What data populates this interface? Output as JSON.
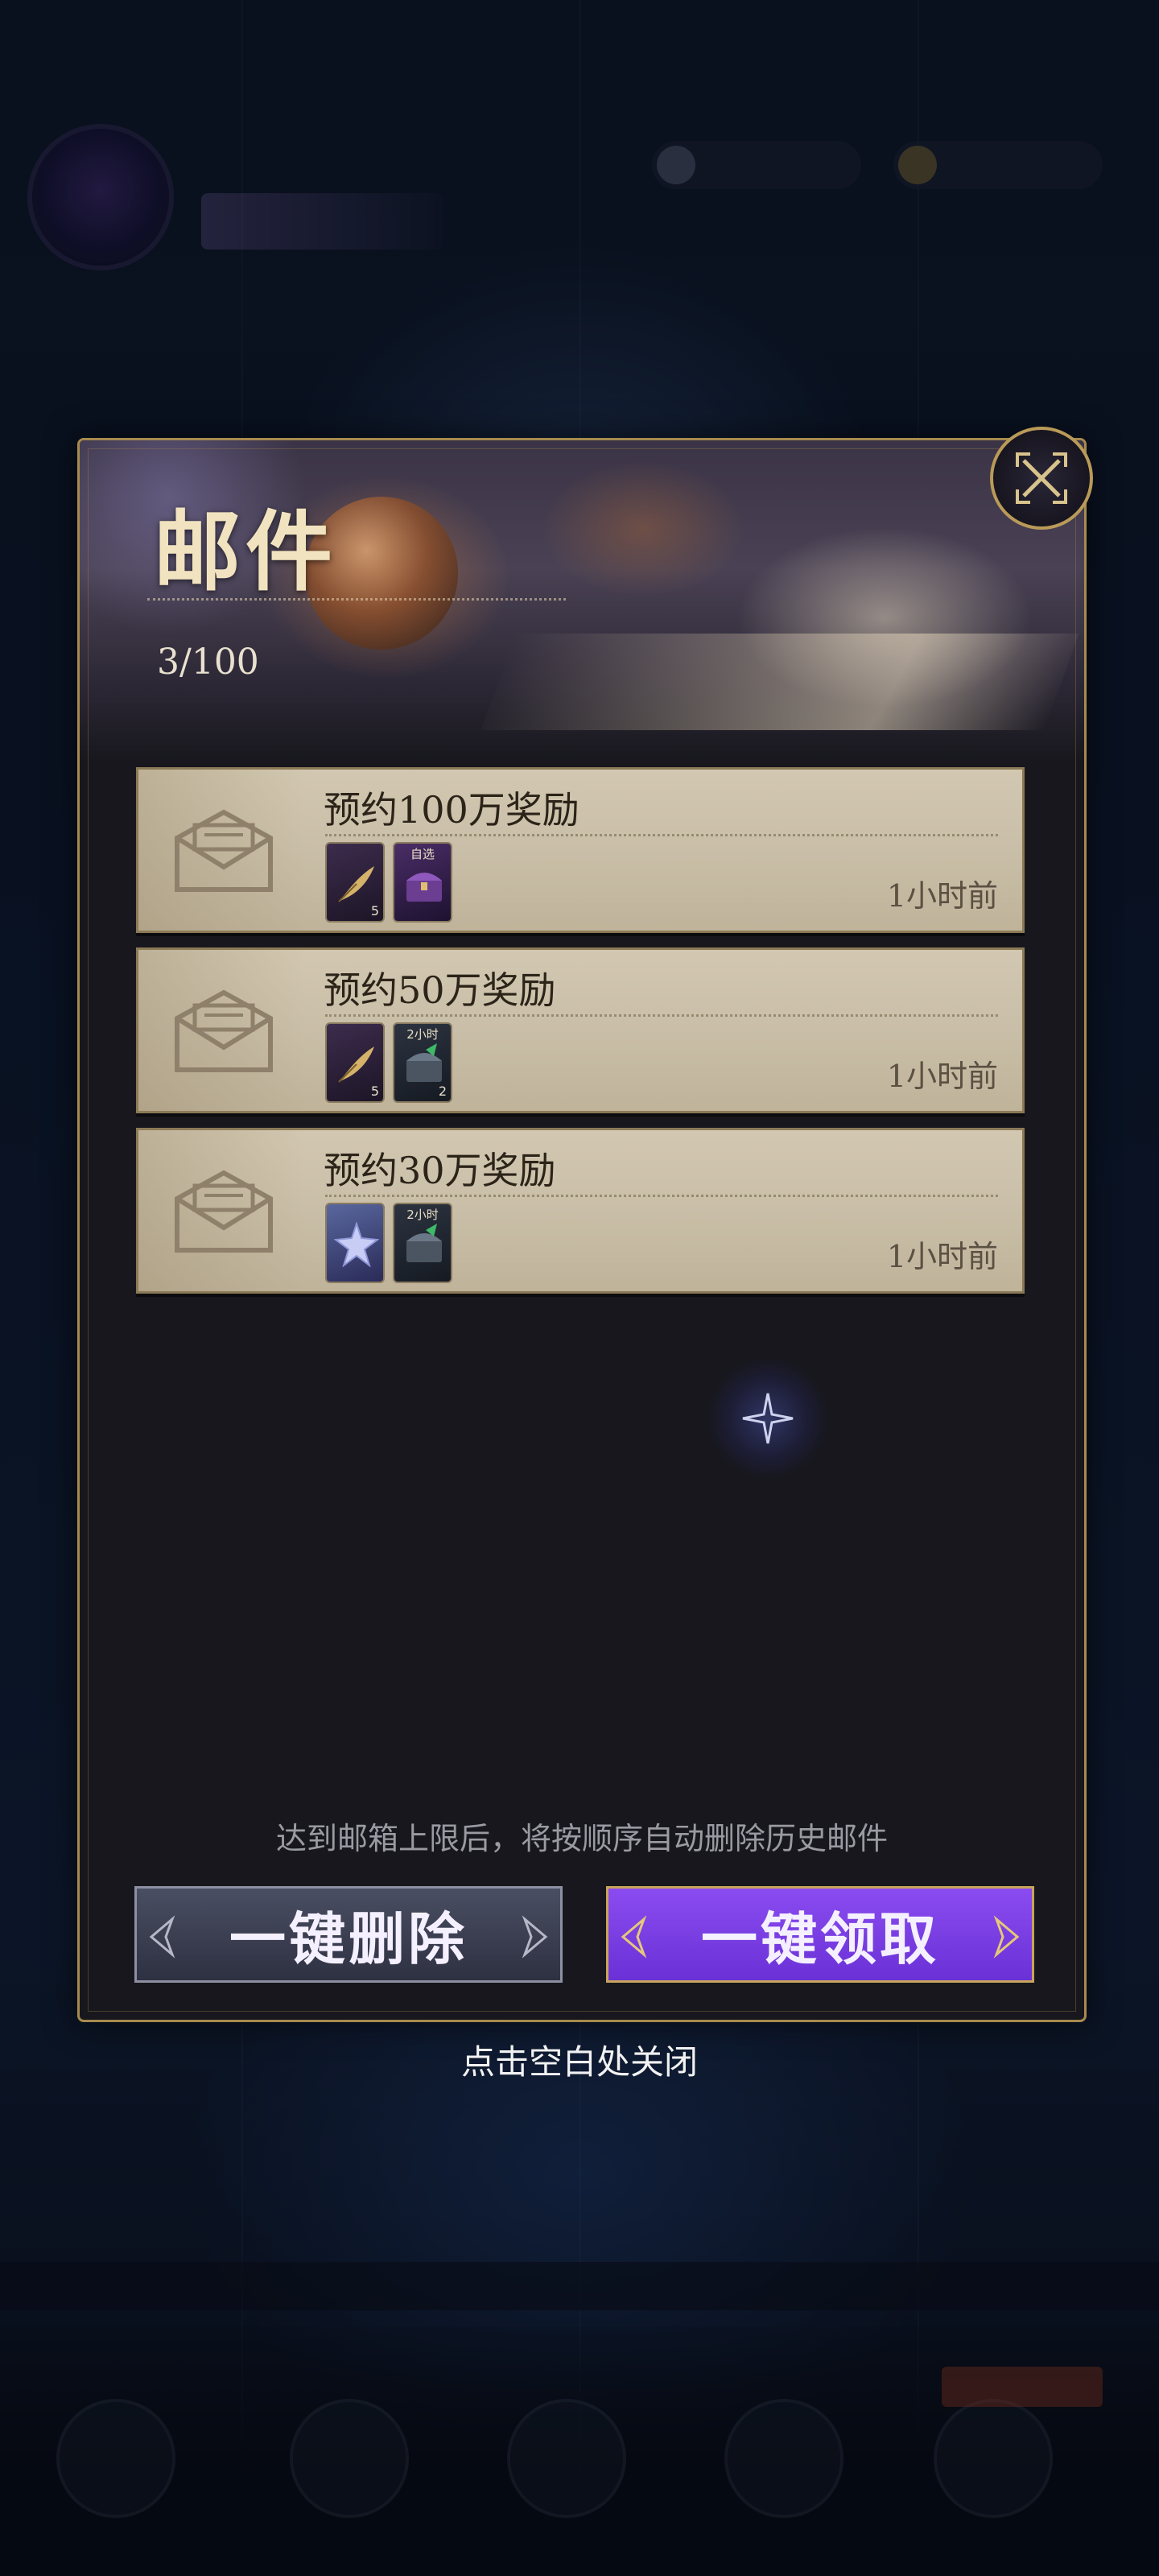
{
  "mail_panel": {
    "title": "邮件",
    "count": "3/100",
    "close_icon": "close-x-icon",
    "mails": [
      {
        "title": "预约100万奖励",
        "time": "1小时前",
        "icon": "envelope-icon",
        "items": [
          {
            "type": "quill",
            "icon": "quill-icon",
            "qty": "5",
            "tag": ""
          },
          {
            "type": "chest-purple",
            "icon": "treasure-chest-icon",
            "qty": "",
            "tag": "自选"
          }
        ]
      },
      {
        "title": "预约50万奖励",
        "time": "1小时前",
        "icon": "envelope-icon",
        "items": [
          {
            "type": "quill",
            "icon": "quill-icon",
            "qty": "5",
            "tag": ""
          },
          {
            "type": "chest-dark",
            "icon": "treasure-chest-icon",
            "qty": "2",
            "tag": "2小时"
          }
        ]
      },
      {
        "title": "预约30万奖励",
        "time": "1小时前",
        "icon": "envelope-icon",
        "items": [
          {
            "type": "star",
            "icon": "star-crystal-icon",
            "qty": "",
            "tag": ""
          },
          {
            "type": "chest-dark",
            "icon": "treasure-chest-icon",
            "qty": "",
            "tag": "2小时"
          }
        ]
      }
    ],
    "footer_note": "达到邮箱上限后，将按顺序自动删除历史邮件",
    "delete_all_label": "一键删除",
    "claim_all_label": "一键领取"
  },
  "close_hint": "点击空白处关闭",
  "colors": {
    "panel_border": "#a78a4e",
    "claim_button": "#7a3fe6",
    "delete_button": "#3b3e52",
    "mail_card": "#c9bea7"
  }
}
